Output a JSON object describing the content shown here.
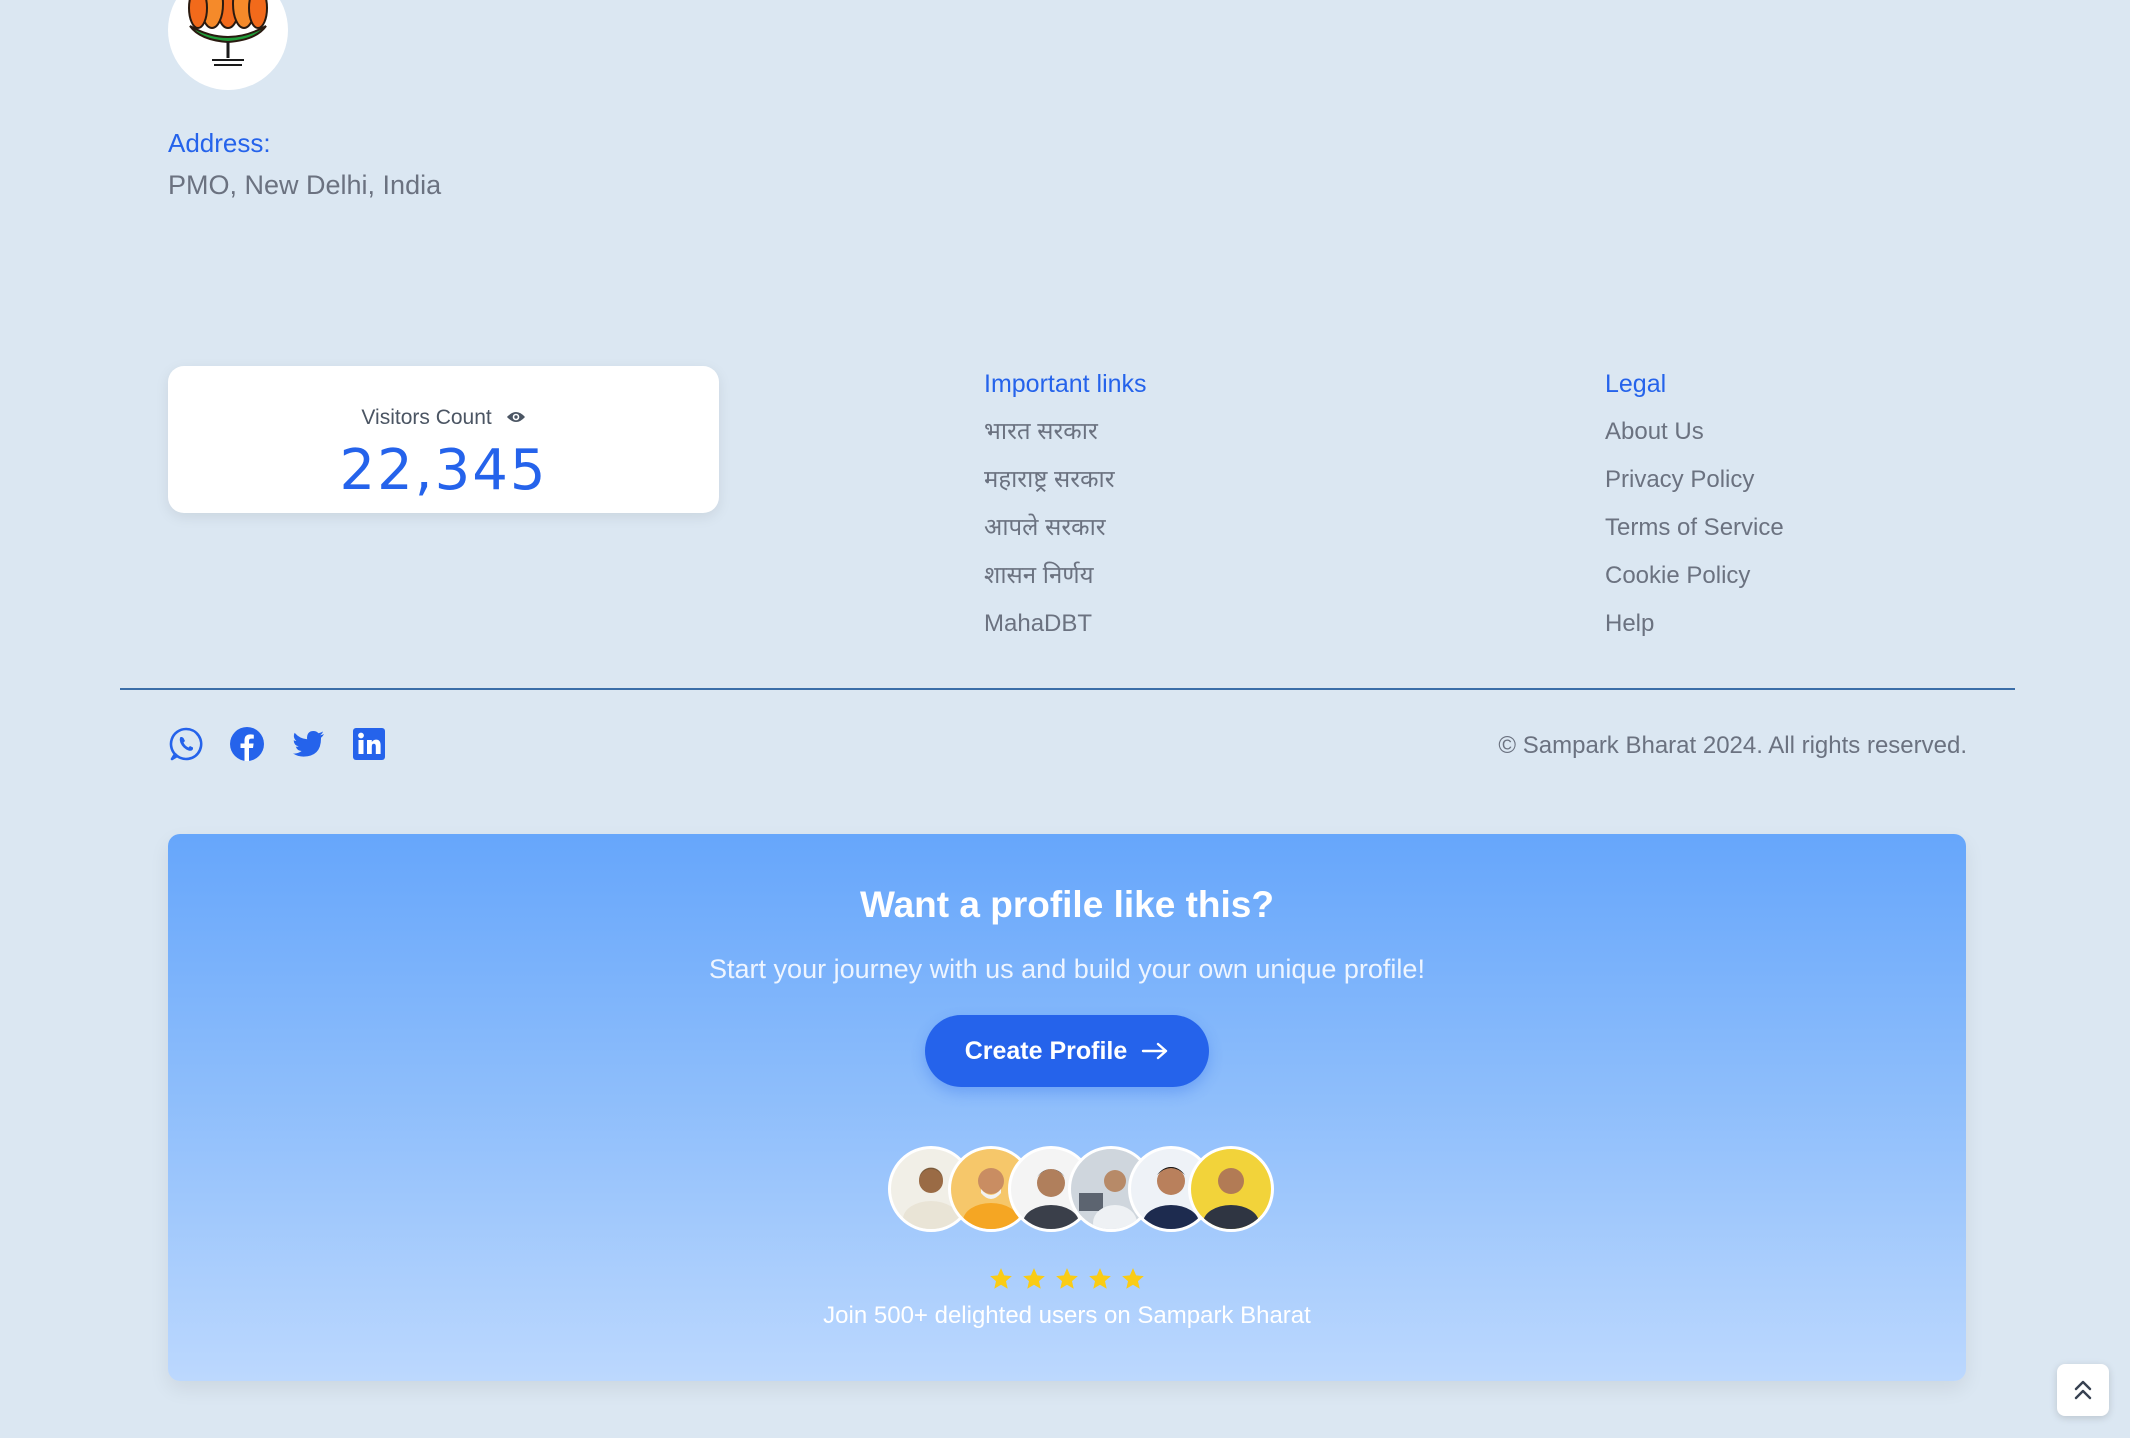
{
  "profile": {
    "address_label": "Address:",
    "address_value": "PMO, New Delhi, India"
  },
  "visitors": {
    "label": "Visitors Count",
    "count": "22,345"
  },
  "important_links": {
    "heading": "Important links",
    "items": [
      "भारत सरकार",
      "महाराष्ट्र सरकार",
      "आपले सरकार",
      "शासन निर्णय",
      "MahaDBT"
    ]
  },
  "legal": {
    "heading": "Legal",
    "items": [
      "About Us",
      "Privacy Policy",
      "Terms of Service",
      "Cookie Policy",
      "Help"
    ]
  },
  "social": {
    "icons": [
      "whatsapp-icon",
      "facebook-icon",
      "twitter-icon",
      "linkedin-icon"
    ],
    "color": "#2563eb"
  },
  "footer": {
    "copyright": "© Sampark Bharat 2024. All rights reserved."
  },
  "cta": {
    "title": "Want a profile like this?",
    "subtitle": "Start your journey with us and build your own unique profile!",
    "button_label": "Create Profile",
    "tagline": "Join 500+ delighted users on Sampark Bharat",
    "rating_stars": 5
  },
  "colors": {
    "accent": "#2563eb",
    "background": "#dbe7f2",
    "star": "#facc15"
  }
}
